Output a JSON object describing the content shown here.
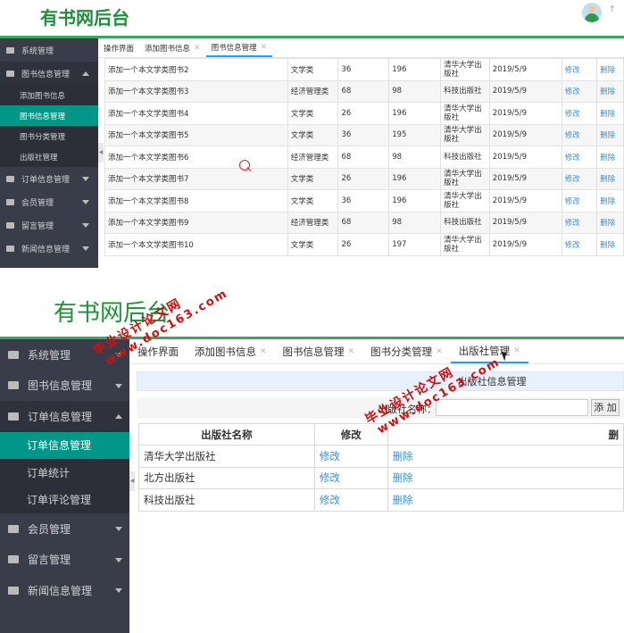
{
  "screen1": {
    "brand": "有书网后台",
    "avatar_caret": "↑",
    "sidebar": {
      "items": [
        {
          "label": "系统管理"
        },
        {
          "label": "图书信息管理"
        },
        {
          "label": "订单信息管理"
        },
        {
          "label": "会员管理"
        },
        {
          "label": "留言管理"
        },
        {
          "label": "新闻信息管理"
        }
      ],
      "sub_items": [
        {
          "label": "添加图书信息"
        },
        {
          "label": "图书信息管理"
        },
        {
          "label": "图书分类管理"
        },
        {
          "label": "出版社管理"
        }
      ]
    },
    "tabs": [
      {
        "label": "操作界面"
      },
      {
        "label": "添加图书信息"
      },
      {
        "label": "图书信息管理"
      }
    ],
    "rows": [
      {
        "name": "添加一个本文学类图书2",
        "category": "文学类",
        "a": "36",
        "b": "196",
        "publisher": "清华大学出版社",
        "date": "2019/5/9",
        "edit": "修改",
        "del": "删除"
      },
      {
        "name": "添加一个本文学类图书3",
        "category": "经济管理类",
        "a": "68",
        "b": "98",
        "publisher": "科技出版社",
        "date": "2019/5/9",
        "edit": "修改",
        "del": "删除"
      },
      {
        "name": "添加一个本文学类图书4",
        "category": "文学类",
        "a": "26",
        "b": "196",
        "publisher": "清华大学出版社",
        "date": "2019/5/9",
        "edit": "修改",
        "del": "删除"
      },
      {
        "name": "添加一个本文学类图书5",
        "category": "文学类",
        "a": "36",
        "b": "195",
        "publisher": "清华大学出版社",
        "date": "2019/5/9",
        "edit": "修改",
        "del": "删除"
      },
      {
        "name": "添加一个本文学类图书6",
        "category": "经济管理类",
        "a": "68",
        "b": "98",
        "publisher": "科技出版社",
        "date": "2019/5/9",
        "edit": "修改",
        "del": "删除"
      },
      {
        "name": "添加一个本文学类图书7",
        "category": "文学类",
        "a": "26",
        "b": "196",
        "publisher": "清华大学出版社",
        "date": "2019/5/9",
        "edit": "修改",
        "del": "删除"
      },
      {
        "name": "添加一个本文学类图书8",
        "category": "文学类",
        "a": "36",
        "b": "196",
        "publisher": "清华大学出版社",
        "date": "2019/5/9",
        "edit": "修改",
        "del": "删除"
      },
      {
        "name": "添加一个本文学类图书9",
        "category": "经济管理类",
        "a": "68",
        "b": "98",
        "publisher": "科技出版社",
        "date": "2019/5/9",
        "edit": "修改",
        "del": "删除"
      },
      {
        "name": "添加一个本文学类图书10",
        "category": "文学类",
        "a": "26",
        "b": "197",
        "publisher": "清华大学出版社",
        "date": "2019/5/9",
        "edit": "修改",
        "del": "删除"
      }
    ]
  },
  "screen2": {
    "brand": "有书网后台",
    "sidebar": {
      "items": [
        {
          "label": "系统管理"
        },
        {
          "label": "图书信息管理"
        },
        {
          "label": "订单信息管理"
        },
        {
          "label": "会员管理"
        },
        {
          "label": "留言管理"
        },
        {
          "label": "新闻信息管理"
        }
      ],
      "sub_items": [
        {
          "label": "订单信息管理"
        },
        {
          "label": "订单统计"
        },
        {
          "label": "订单评论管理"
        }
      ]
    },
    "tabs": [
      {
        "label": "操作界面"
      },
      {
        "label": "添加图书信息"
      },
      {
        "label": "图书信息管理"
      },
      {
        "label": "图书分类管理"
      },
      {
        "label": "出版社管理"
      }
    ],
    "panel_title": "出版社信息管理",
    "search": {
      "label": "出版社名称：",
      "value": "",
      "button": "添 加"
    },
    "table": {
      "headers": [
        "出版社名称",
        "修改",
        "删"
      ],
      "rows": [
        {
          "name": "清华大学出版社",
          "edit": "修改",
          "del": "删除"
        },
        {
          "name": "北方出版社",
          "edit": "修改",
          "del": "删除"
        },
        {
          "name": "科技出版社",
          "edit": "修改",
          "del": "删除"
        }
      ]
    }
  },
  "watermark": {
    "line1": "毕业设计论文网",
    "line2": "www.doc163.com"
  },
  "colors": {
    "brand": "#1f8f3a",
    "sidebar_bg": "#393d49",
    "active_item": "#009688",
    "link": "#3f8fd2",
    "watermark": "#d01010"
  }
}
